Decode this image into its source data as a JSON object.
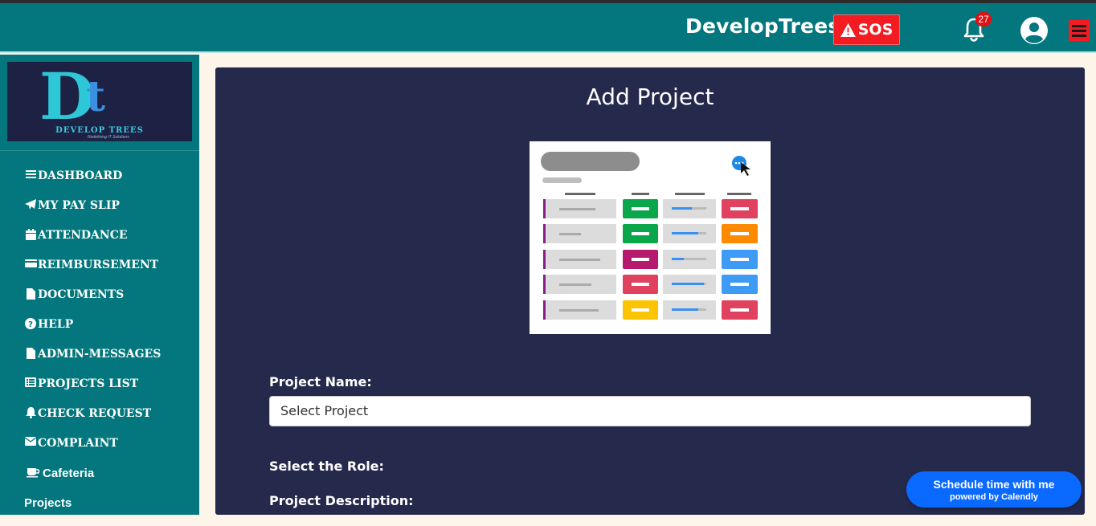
{
  "header": {
    "brand": "DevelopTrees",
    "sos_label": "SOS",
    "notification_count": "27"
  },
  "logo": {
    "letters": "Dt",
    "name": "DEVELOP TREES",
    "tagline": "Redefining IT Solutions"
  },
  "sidebar": {
    "items": [
      {
        "label": "DASHBOARD",
        "icon": "bars-icon"
      },
      {
        "label": "MY PAY SLIP",
        "icon": "paper-plane-icon"
      },
      {
        "label": "ATTENDANCE",
        "icon": "calendar-icon"
      },
      {
        "label": "REIMBURSEMENT",
        "icon": "credit-card-icon"
      },
      {
        "label": "DOCUMENTS",
        "icon": "file-icon"
      },
      {
        "label": "HELP",
        "icon": "question-circle-icon"
      },
      {
        "label": "ADMIN-MESSAGES",
        "icon": "file-icon"
      },
      {
        "label": "PROJECTS LIST",
        "icon": "list-icon"
      },
      {
        "label": "CHECK REQUEST",
        "icon": "bell-icon"
      },
      {
        "label": "COMPLAINT",
        "icon": "envelope-icon"
      },
      {
        "label": "Cafeteria",
        "icon": "coffee-icon"
      },
      {
        "label": "Projects",
        "icon": ""
      }
    ]
  },
  "main": {
    "title": "Add Project",
    "project_name_label": "Project Name:",
    "project_select_value": "Select Project",
    "role_label": "Select the Role:",
    "description_label": "Project Description:"
  },
  "calendly": {
    "line1": "Schedule time with me",
    "line2": "powered by Calendly"
  },
  "colors": {
    "navbar": "#03777d",
    "sos": "#f21c22",
    "card": "#25294c",
    "calendly": "#0a69ff"
  }
}
